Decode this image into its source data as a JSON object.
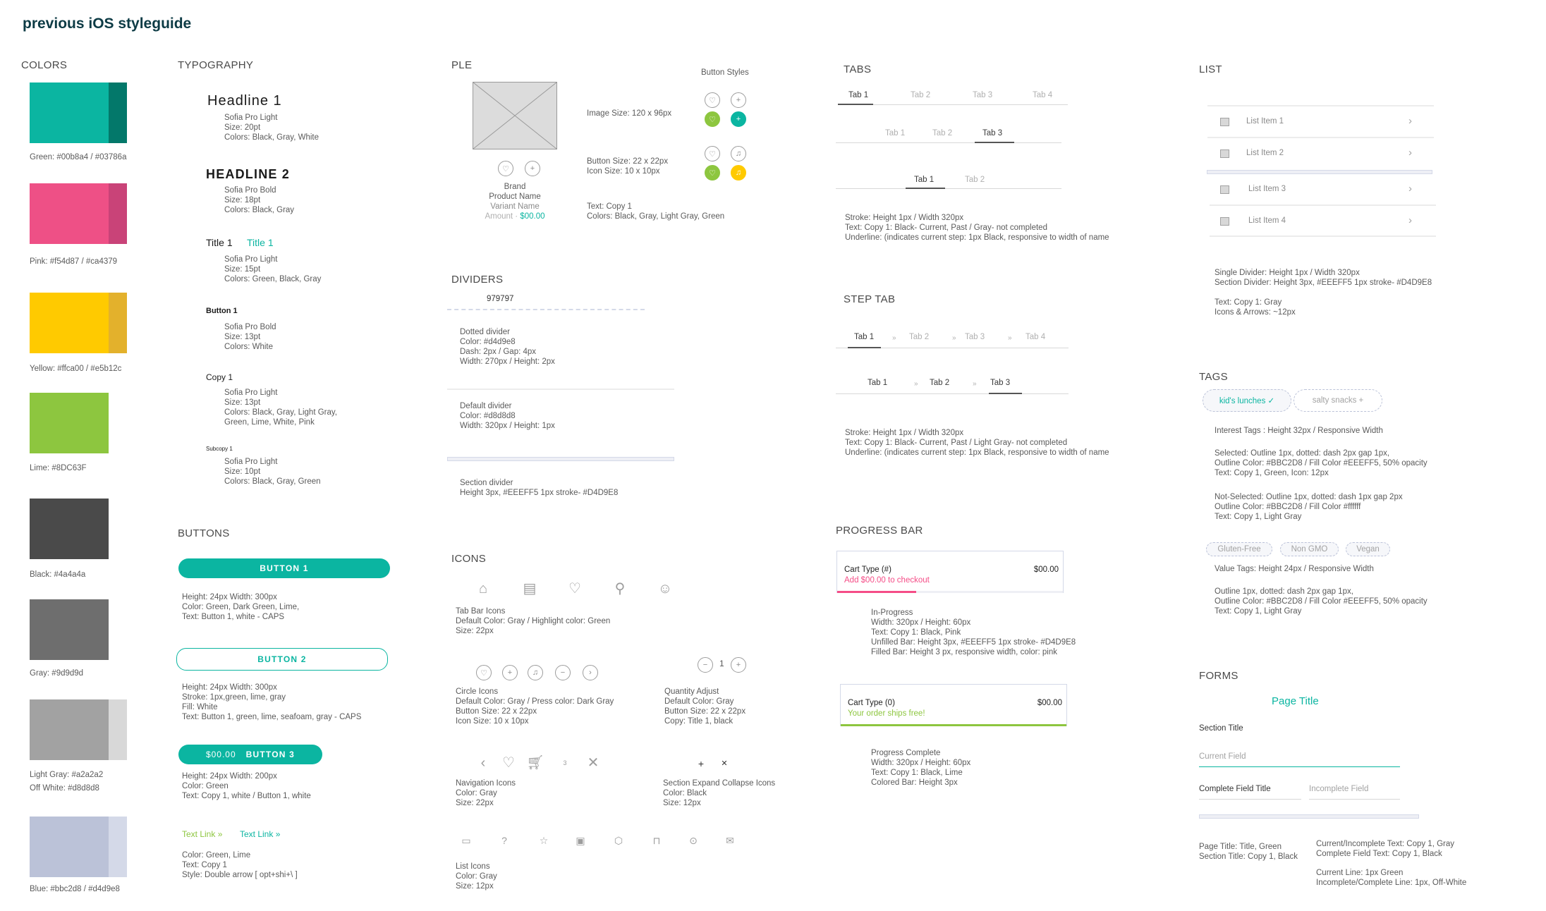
{
  "header": {
    "title": "previous iOS styleguide"
  },
  "colors": {
    "heading": "COLORS",
    "swatches": [
      {
        "name": "green",
        "label": "Green: #00b8a4 / #03786a",
        "main": "#0bb5a1",
        "alt": "#03786a"
      },
      {
        "name": "pink",
        "label": "Pink: #f54d87 / #ca4379",
        "main": "#ee5086",
        "alt": "#c94378"
      },
      {
        "name": "yellow",
        "label": "Yellow: #ffca00 / #e5b12c",
        "main": "#ffca00",
        "alt": "#e3b12c"
      },
      {
        "name": "lime",
        "label": "Lime: #8DC63F",
        "main": "#8dc63f",
        "alt": null
      },
      {
        "name": "black",
        "label": "Black: #4a4a4a",
        "main": "#4a4a4a",
        "alt": null
      },
      {
        "name": "gray",
        "label": "Gray: #9d9d9d",
        "main": "#6e6e6e",
        "alt": null
      },
      {
        "name": "light-gray",
        "label": "Light Gray: #a2a2a2\nOff White: #d8d8d8",
        "main": "#a2a2a2",
        "alt": "#d8d8d8"
      },
      {
        "name": "blue",
        "label": "Blue: #bbc2d8  /  #d4d9e8",
        "main": "#bbc2d8",
        "alt": "#d4d9e8"
      }
    ]
  },
  "typography": {
    "heading": "TYPOGRAPHY",
    "styles": [
      {
        "sample": "Headline 1",
        "meta": "Sofia Pro Light\nSize: 20pt\nColors: Black, Gray, White"
      },
      {
        "sample": "HEADLINE 2",
        "meta": "Sofia Pro Bold\nSize: 18pt\nColors: Black, Gray"
      },
      {
        "sample": "Title 1",
        "sample_alt": "Title 1",
        "meta": "Sofia Pro Light\nSize: 15pt\nColors: Green, Black, Gray"
      },
      {
        "sample": "Button 1",
        "meta": "Sofia Pro Bold\nSize: 13pt\nColors: White"
      },
      {
        "sample": "Copy 1",
        "meta": "Sofia Pro Light\nSize: 13pt\nColors: Black, Gray, Light Gray,\nGreen, Lime, White, Pink"
      },
      {
        "sample": "Subcopy 1",
        "meta": "Sofia Pro Light\nSize: 10pt\nColors: Black, Gray, Green"
      }
    ]
  },
  "buttons": {
    "heading": "BUTTONS",
    "button1": {
      "label": "BUTTON 1",
      "note": "Height: 24px  Width: 300px\nColor: Green, Dark Green, Lime,\nText: Button 1, white - CAPS"
    },
    "button2": {
      "label": "BUTTON 2",
      "note": "Height: 24px  Width: 300px\nStroke: 1px,green, lime, gray\nFill: White\nText: Button 1, green, lime, seafoam, gray - CAPS"
    },
    "button3": {
      "price": "$00.00",
      "label": "BUTTON 3",
      "note": "Height: 24px  Width: 200px\nColor: Green\nText:  Copy 1, white  /  Button 1, white"
    },
    "text_links": {
      "lime": "Text Link »",
      "green": "Text Link »",
      "note": "Color: Green, Lime\nText: Copy 1\nStyle: Double arrow [ opt+shi+\\ ]"
    }
  },
  "ple": {
    "heading": "PLE",
    "button_styles_label": "Button Styles",
    "brand": "Brand",
    "product_name": "Product Name",
    "variant_name": "Variant Name",
    "amount_label": "Amount",
    "amount_sep": "·",
    "price": "$00.00",
    "image_size": "Image Size: 120 x 96px",
    "button_size": "Button Size: 22 x 22px\nIcon Size: 10 x 10px",
    "text_note": "Text: Copy 1\nColors: Black, Gray, Light Gray, Green"
  },
  "dividers": {
    "heading": "DIVIDERS",
    "hex_label": "979797",
    "dotted_note": "Dotted divider\nColor: #d4d9e8\nDash: 2px   /  Gap: 4px\nWidth: 270px  /  Height: 2px",
    "default_note": "Default divider\nColor: #d8d8d8\nWidth: 320px  /  Height: 1px",
    "section_note": "Section divider\nHeight 3px, #EEEFF5 1px stroke- #D4D9E8"
  },
  "icons": {
    "heading": "ICONS",
    "tab_bar_note": "Tab Bar Icons\nDefault Color: Gray  /  Highlight color: Green\nSize: 22px",
    "circle_note": "Circle Icons\nDefault Color: Gray  /  Press color: Dark Gray\nButton Size: 22 x 22px\nIcon Size: 10 x 10px",
    "quantity_value": "1",
    "quantity_note": "Quantity Adjust\nDefault Color: Gray\nButton Size: 22 x 22px\nCopy: Title 1, black",
    "nav_note": "Navigation Icons\nColor: Gray\nSize: 22px",
    "cart_badge": "3",
    "expand_note": "Section Expand Collapse Icons\nColor: Black\nSize: 12px",
    "list_note": "List Icons\nColor: Gray\nSize: 12px"
  },
  "tabs": {
    "heading": "TABS",
    "row1": [
      "Tab 1",
      "Tab 2",
      "Tab 3",
      "Tab 4"
    ],
    "row2": [
      "Tab 1",
      "Tab 2",
      "Tab 3"
    ],
    "row3": [
      "Tab 1",
      "Tab 2"
    ],
    "note": "Stroke: Height 1px / Width 320px\nText: Copy 1: Black- Current, Past  /  Gray- not completed\nUnderline: (indicates current step: 1px Black, responsive to width of name"
  },
  "step_tab": {
    "heading": "STEP TAB",
    "separator": "»",
    "row1": [
      "Tab 1",
      "Tab 2",
      "Tab 3",
      "Tab 4"
    ],
    "row2": [
      "Tab 1",
      "Tab 2",
      "Tab 3"
    ],
    "note": "Stroke: Height 1px / Width 320px\nText: Copy 1: Black- Current, Past  /  Light Gray- not completed\nUnderline: (indicates current step: 1px Black, responsive to width of name"
  },
  "progress_bar": {
    "heading": "PROGRESS BAR",
    "in_progress": {
      "title": "Cart Type (#)",
      "subtitle": "Add $00.00 to checkout",
      "price": "$00.00",
      "progress": 0.35,
      "color": "#f54d87"
    },
    "in_progress_note": "In-Progress\nWidth: 320px  /  Height: 60px\nText: Copy 1: Black, Pink\nUnfilled Bar: Height 3px, #EEEFF5 1px stroke- #D4D9E8\nFilled Bar: Height 3 px, responsive width, color: pink",
    "complete": {
      "title": "Cart Type (0)",
      "subtitle": "Your order ships free!",
      "price": "$00.00",
      "progress": 1.0,
      "color": "#8dc63f"
    },
    "complete_note": "Progress Complete\nWidth: 320px  /  Height: 60px\nText: Copy 1: Black, Lime\nColored Bar: Height 3px"
  },
  "list": {
    "heading": "LIST",
    "items": [
      "List Item 1",
      "List Item 2",
      "List Item  3",
      "List Item 4"
    ],
    "note1": "Single Divider: Height 1px / Width 320px\nSection Divider: Height 3px, #EEEFF5 1px stroke- #D4D9E8",
    "note2": "Text: Copy 1: Gray\nIcons & Arrows: ~12px"
  },
  "tags": {
    "heading": "TAGS",
    "selected": "kid's lunches ✓",
    "unselected": "salty snacks +",
    "interest_note": "Interest Tags : Height 32px / Responsive Width",
    "selected_note": "Selected: Outline 1px, dotted: dash 2px gap 1px,\nOutline Color: #BBC2D8 /   Fill Color #EEEFF5, 50% opacity\nText: Copy 1, Green, Icon: 12px",
    "unselected_note": "Not-Selected: Outline 1px, dotted: dash 1px gap 2px\nOutline Color: #BBC2D8 /   Fill Color #ffffff\nText: Copy 1, Light Gray",
    "value_tags": [
      "Gluten-Free",
      "Non GMO",
      "Vegan"
    ],
    "value_note": "Value Tags: Height 24px / Responsive Width",
    "value_style_note": "Outline 1px, dotted: dash 2px gap 1px,\nOutline Color: #BBC2D8 /   Fill Color #EEEFF5, 50% opacity\nText: Copy 1, Light Gray"
  },
  "forms": {
    "heading": "FORMS",
    "page_title": "Page Title",
    "section_title": "Section Title",
    "current_field": "Current Field",
    "complete_field": "Complete Field Title",
    "incomplete_field": "Incomplete Field",
    "note_left": "Page Title: Title, Green\nSection Title: Copy 1, Black",
    "note_right1": "Current/Incomplete Text: Copy 1, Gray\nComplete Field Text: Copy 1, Black",
    "note_right2": "Current Line: 1px Green\nIncomplete/Complete Line: 1px, Off-White"
  }
}
